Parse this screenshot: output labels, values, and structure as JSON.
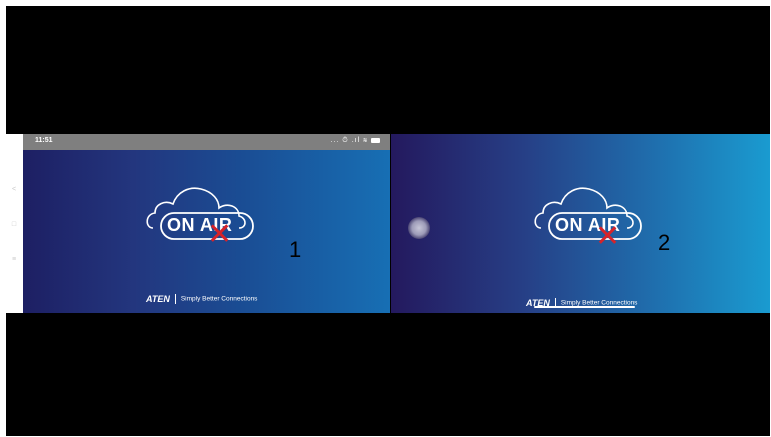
{
  "status_bar": {
    "time": "11:51",
    "icons": [
      "dots-icon",
      "alarm-icon",
      "signal-icon",
      "wifi-icon",
      "battery-icon"
    ],
    "icons_text": "... ⏱ .ıl ≋"
  },
  "nav_buttons": [
    {
      "icon": "back-icon",
      "glyph": "<"
    },
    {
      "icon": "home-icon",
      "glyph": "□"
    },
    {
      "icon": "menu-icon",
      "glyph": "≡"
    }
  ],
  "left_panel": {
    "logo_text": "ON AIR",
    "step_number": "1",
    "brand_name": "ATEN",
    "brand_tagline": "Simply Better Connections"
  },
  "right_panel": {
    "logo_text": "ON AIR",
    "step_number": "2",
    "brand_name": "ATEN",
    "brand_tagline": "Simply Better Connections"
  },
  "red_x_glyph": "✕",
  "colors": {
    "red_x": "#d6232a",
    "status_bar": "#7f7f7f",
    "background": "#000000"
  }
}
